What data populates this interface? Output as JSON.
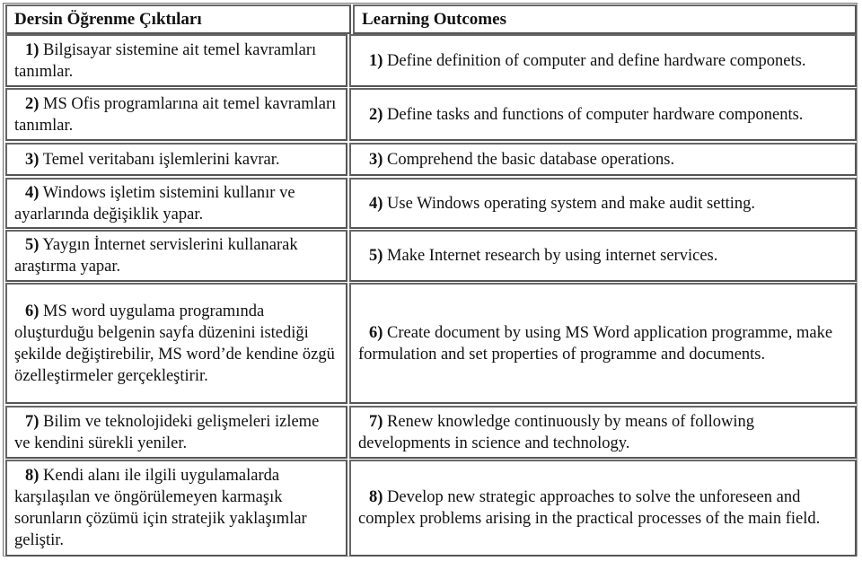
{
  "table": {
    "headers": {
      "tr": "Dersin Öğrenme Çıktıları",
      "en": "Learning Outcomes"
    },
    "rows": [
      {
        "num": "1)",
        "tr": "Bilgisayar sistemine ait temel kavramları tanımlar.",
        "en": "Define definition of computer and define hardware componets."
      },
      {
        "num": "2)",
        "tr": "MS Ofis programlarına ait temel kavramları tanımlar.",
        "en": "Define tasks and functions of computer hardware components."
      },
      {
        "num": "3)",
        "tr": "Temel veritabanı işlemlerini kavrar.",
        "en": "Comprehend the basic database operations."
      },
      {
        "num": "4)",
        "tr": "Windows işletim sistemini kullanır ve ayarlarında değişiklik yapar.",
        "en": "Use Windows operating system and make audit setting."
      },
      {
        "num": "5)",
        "tr": "Yaygın İnternet servislerini kullanarak araştırma yapar.",
        "en": "Make Internet research by using internet services."
      },
      {
        "num": "6)",
        "tr": "MS word uygulama programında oluşturduğu belgenin sayfa düzenini istediği şekilde değiştirebilir, MS word’de kendine özgü özelleştirmeler gerçekleştirir.",
        "en": "Create document by using MS Word application programme, make formulation and set properties of programme and documents."
      },
      {
        "num": "7)",
        "tr": "Bilim ve teknolojideki gelişmeleri izleme ve kendini sürekli yeniler.",
        "en": "Renew knowledge continuously by means of following developments in science and technology."
      },
      {
        "num": "8)",
        "tr": "Kendi alanı ile ilgili uygulamalarda karşılaşılan ve öngörülemeyen karmaşık sorunların çözümü için stratejik yaklaşımlar geliştir.",
        "en": "Develop new strategic approaches to solve the unforeseen and complex problems arising in the practical processes of the main field."
      }
    ]
  }
}
